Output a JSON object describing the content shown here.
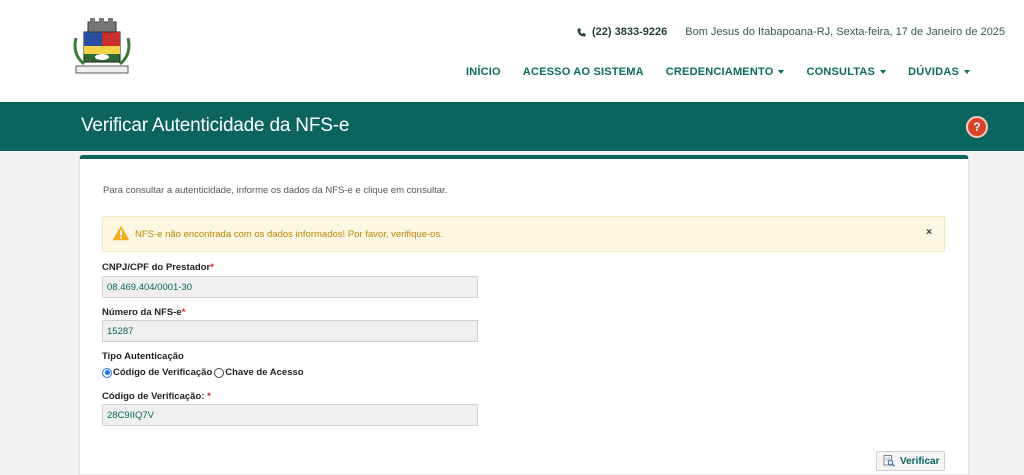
{
  "header": {
    "phone": "(22) 3833-9226",
    "location_date": "Bom Jesus do Itabapoana-RJ, Sexta-feira, 17 de Janeiro de 2025",
    "nav": [
      {
        "label": "INÍCIO",
        "dropdown": false
      },
      {
        "label": "ACESSO AO SISTEMA",
        "dropdown": false
      },
      {
        "label": "CREDENCIAMENTO",
        "dropdown": true
      },
      {
        "label": "CONSULTAS",
        "dropdown": true
      },
      {
        "label": "DÚVIDAS",
        "dropdown": true
      }
    ]
  },
  "page": {
    "title": "Verificar Autenticidade da NFS-e",
    "help_icon": "?"
  },
  "form": {
    "intro": "Para consultar a autenticidade, informe os dados da NFS-e e clique em consultar.",
    "alert": "NFS-e não encontrada com os dados informados! Por favor, verifique-os.",
    "alert_close": "×",
    "cnpj_label": "CNPJ/CPF do Prestador",
    "cnpj_value": "08.469.404/0001-30",
    "numero_label": "Número da NFS-e",
    "numero_value": "15287",
    "tipo_label": "Tipo Autenticação",
    "tipo_options": [
      "Código de Verificação",
      "Chave de Acesso"
    ],
    "tipo_selected": "Código de Verificação",
    "codigo_label": "Código de Verificação:",
    "codigo_value": "28C9IIQ7V",
    "required_mark": "*",
    "verify_button": "Verificar"
  },
  "colors": {
    "primary": "#0b655e",
    "alert_bg": "#fcf7e0",
    "alert_text": "#b8860b",
    "help_red": "#d9432c"
  }
}
